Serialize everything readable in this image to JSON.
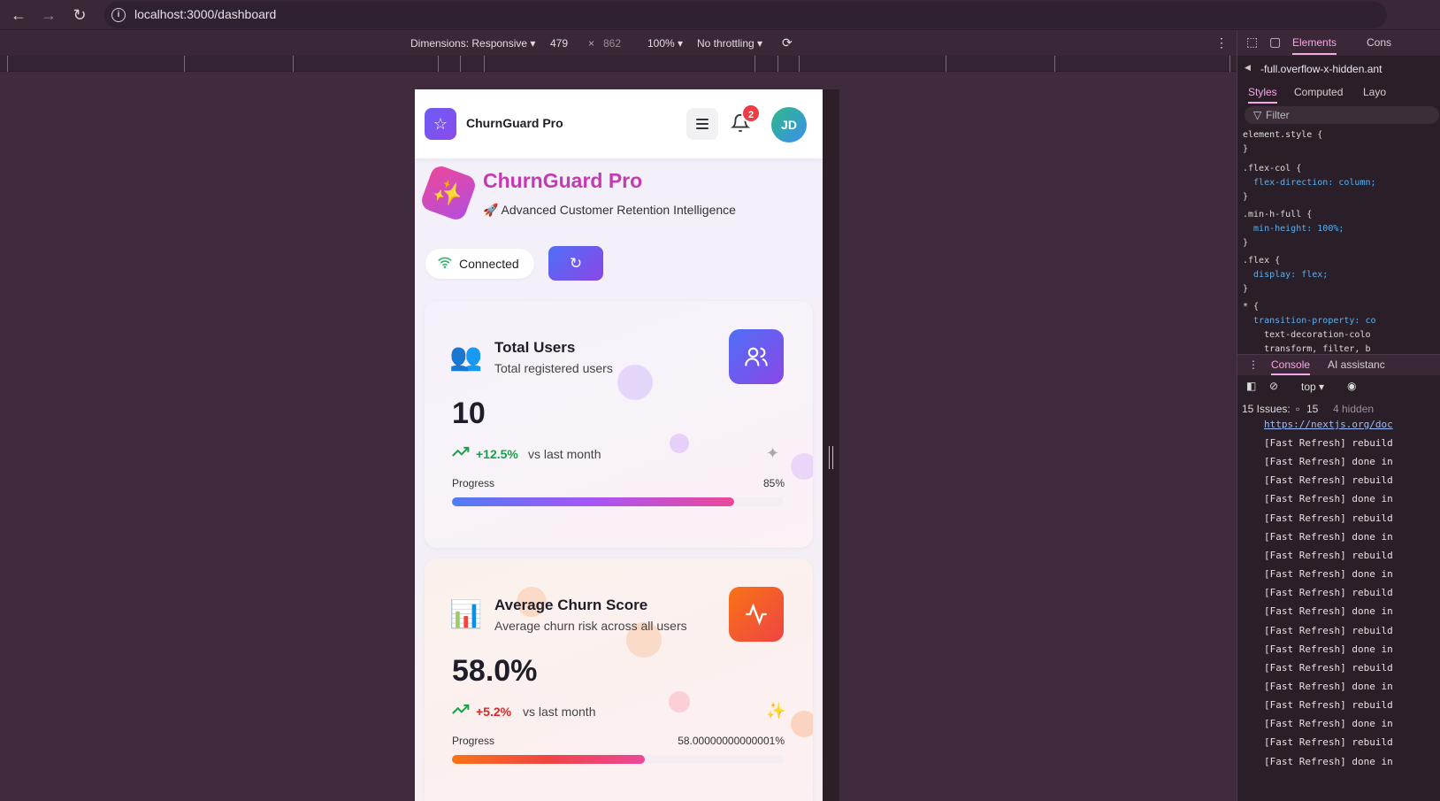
{
  "browser": {
    "back_icon": "arrow-left-icon",
    "forward_icon": "arrow-right-icon",
    "reload_icon": "reload-icon",
    "url": "localhost:3000/dashboard"
  },
  "device_toolbar": {
    "dimensions_label": "Dimensions: Responsive ▾",
    "width": "479",
    "times": "×",
    "height": "862",
    "zoom": "100% ▾",
    "throttling": "No throttling ▾",
    "more_icon": "⋮"
  },
  "app": {
    "brand": "ChurnGuard Pro",
    "notification_count": "2",
    "avatar_initials": "JD",
    "hero_title": "ChurnGuard Pro",
    "hero_subtitle": "🚀 Advanced Customer Retention Intelligence",
    "connection_status": "Connected",
    "cards": [
      {
        "emoji": "👥",
        "title": "Total Users",
        "subtitle": "Total registered users",
        "value": "10",
        "trend": "+12.5%",
        "trend_label": "vs last month",
        "trend_color": "#16a34a",
        "progress_label": "Progress",
        "progress_text": "85%",
        "progress_fraction": 0.85,
        "badge_icon": "users-icon"
      },
      {
        "emoji": "📊",
        "title": "Average Churn Score",
        "subtitle": "Average churn risk across all users",
        "value": "58.0%",
        "trend": "+5.2%",
        "trend_label": "vs last month",
        "trend_color": "#dc2626",
        "progress_label": "Progress",
        "progress_text": "58.00000000000001%",
        "progress_fraction": 0.58,
        "badge_icon": "activity-icon"
      }
    ]
  },
  "devtools": {
    "tabs": [
      "Elements",
      "Cons"
    ],
    "breadcrumb": "-full.overflow-x-hidden.ant",
    "subtabs": [
      "Styles",
      "Computed",
      "Layo"
    ],
    "filter_placeholder": "Filter",
    "css_rules": [
      {
        "selector": "element.style {",
        "lines": [
          "}"
        ]
      },
      {
        "selector": ".flex-col {",
        "lines": [
          "  flex-direction: column;",
          "}"
        ]
      },
      {
        "selector": ".min-h-full {",
        "lines": [
          "  min-height: 100%;",
          "}"
        ]
      },
      {
        "selector": ".flex {",
        "lines": [
          "  display: flex;",
          "}"
        ]
      },
      {
        "selector": "* {",
        "lines": [
          "  transition-property: co",
          "    text-decoration-colo",
          "    transform, filter, b"
        ]
      }
    ],
    "console_tabs": [
      "Console",
      "AI assistanc"
    ],
    "context": "top ▾",
    "issues": "15 Issues:",
    "issues_count": "15",
    "hidden": "4 hidden",
    "link_line": "https://nextjs.org/doc",
    "log_lines": [
      "[Fast Refresh] rebuild",
      "[Fast Refresh] done in",
      "[Fast Refresh] rebuild",
      "[Fast Refresh] done in",
      "[Fast Refresh] rebuild",
      "[Fast Refresh] done in",
      "[Fast Refresh] rebuild",
      "[Fast Refresh] done in",
      "[Fast Refresh] rebuild",
      "[Fast Refresh] done in",
      "[Fast Refresh] rebuild",
      "[Fast Refresh] done in",
      "[Fast Refresh] rebuild",
      "[Fast Refresh] done in",
      "[Fast Refresh] rebuild",
      "[Fast Refresh] done in",
      "[Fast Refresh] rebuild",
      "[Fast Refresh] done in"
    ]
  },
  "colors": {
    "brand_gradient_start": "#6d5cf5",
    "brand_gradient_end": "#8a4bea",
    "hero_title": "#c43ab3",
    "users_badge": "#7c4ef0",
    "churn_badge": "#f04438",
    "devtools_accent": "#f4a9e6"
  }
}
